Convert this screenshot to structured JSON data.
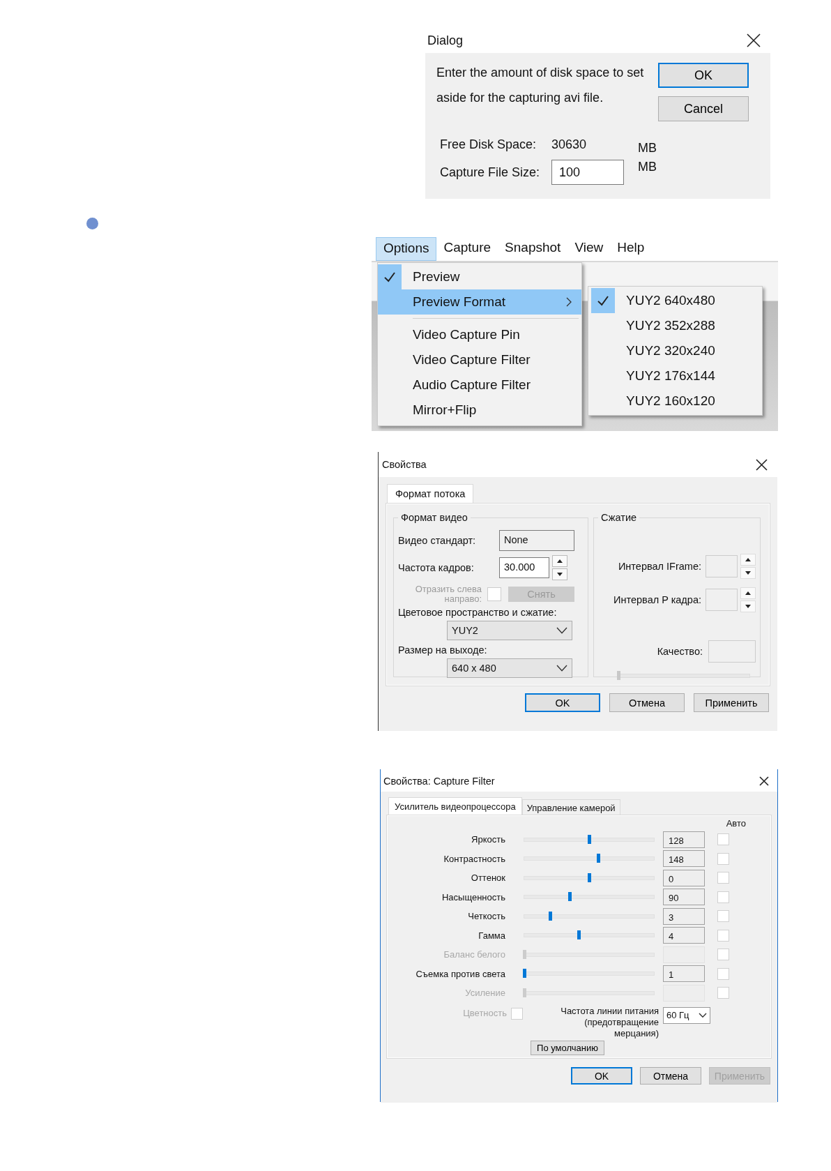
{
  "disk_dialog": {
    "title": "Dialog",
    "message": "Enter the amount of disk space to set aside for the capturing avi file.",
    "buttons": [
      {
        "label": "OK",
        "default": true
      },
      {
        "label": "Cancel",
        "default": false
      }
    ],
    "free_space": {
      "label": "Free Disk Space:",
      "value": "30630",
      "unit": "MB"
    },
    "file_size": {
      "label": "Capture File Size:",
      "value": "100",
      "unit": "MB"
    }
  },
  "capture_menu": {
    "menubar": [
      {
        "label": "Options",
        "selected": true
      },
      {
        "label": "Capture",
        "selected": false
      },
      {
        "label": "Snapshot",
        "selected": false
      },
      {
        "label": "View",
        "selected": false
      },
      {
        "label": "Help",
        "selected": false
      }
    ],
    "items": [
      {
        "kind": "item",
        "label": "Preview",
        "checked": true,
        "highlighted": false,
        "submenu": false
      },
      {
        "kind": "item",
        "label": "Preview Format",
        "checked": false,
        "highlighted": true,
        "submenu": true
      },
      {
        "kind": "separator"
      },
      {
        "kind": "item",
        "label": "Video Capture Pin",
        "checked": false,
        "highlighted": false,
        "submenu": false
      },
      {
        "kind": "item",
        "label": "Video Capture Filter",
        "checked": false,
        "highlighted": false,
        "submenu": false
      },
      {
        "kind": "item",
        "label": "Audio Capture Filter",
        "checked": false,
        "highlighted": false,
        "submenu": false
      },
      {
        "kind": "item",
        "label": "Mirror+Flip",
        "checked": false,
        "highlighted": false,
        "submenu": false
      }
    ],
    "submenu": [
      {
        "label": "YUY2 640x480",
        "checked": true
      },
      {
        "label": "YUY2 352x288",
        "checked": false
      },
      {
        "label": "YUY2 320x240",
        "checked": false
      },
      {
        "label": "YUY2 176x144",
        "checked": false
      },
      {
        "label": "YUY2 160x120",
        "checked": false
      }
    ]
  },
  "properties": {
    "title": "Свойства",
    "tabs": [
      {
        "label": "Формат потока",
        "selected": true
      }
    ],
    "video_format": {
      "title": "Формат видео",
      "standard": {
        "label": "Видео стандарт:",
        "value": "None"
      },
      "frame_rate": {
        "label": "Частота кадров:",
        "value": "30.000"
      },
      "mirror": {
        "label": "Отразить слева направо:",
        "checked": false,
        "disabled": true,
        "button": "Снять"
      },
      "color_space": {
        "label": "Цветовое пространство и сжатие:",
        "value": "YUY2"
      },
      "output_size": {
        "label": "Размер на выходе:",
        "value": "640 x 480"
      }
    },
    "compression": {
      "title": "Сжатие",
      "disabled": true,
      "iframe_label": "Интервал IFrame:",
      "pframe_label": "Интервал P кадра:",
      "quality_label": "Качество:",
      "quality": {
        "level": 0
      }
    },
    "buttons": [
      {
        "label": "OK",
        "default": true,
        "disabled": false
      },
      {
        "label": "Отмена",
        "default": false,
        "disabled": false
      },
      {
        "label": "Применить",
        "default": false,
        "disabled": false
      }
    ]
  },
  "capture_filter": {
    "title": "Свойства: Capture Filter",
    "tabs": [
      {
        "label": "Усилитель видеопроцессора",
        "selected": true
      },
      {
        "label": "Управление камерой",
        "selected": false
      }
    ],
    "auto_header": "Авто",
    "rows": [
      {
        "label": "Яркость",
        "level": 0.5,
        "value": "128",
        "auto": false,
        "disabled": false
      },
      {
        "label": "Контрастность",
        "level": 0.57,
        "value": "148",
        "auto": false,
        "disabled": false
      },
      {
        "label": "Оттенок",
        "level": 0.5,
        "value": "0",
        "auto": false,
        "disabled": false
      },
      {
        "label": "Насыщенность",
        "level": 0.35,
        "value": "90",
        "auto": false,
        "disabled": false
      },
      {
        "label": "Четкость",
        "level": 0.2,
        "value": "3",
        "auto": false,
        "disabled": false
      },
      {
        "label": "Гамма",
        "level": 0.42,
        "value": "4",
        "auto": false,
        "disabled": false
      },
      {
        "label": "Баланс белого",
        "level": 0,
        "auto": false,
        "disabled": true
      },
      {
        "label": "Съемка против света",
        "level": 0,
        "value": "1",
        "auto": false,
        "disabled": false
      },
      {
        "label": "Усиление",
        "level": 0,
        "auto": false,
        "disabled": true
      }
    ],
    "color": {
      "label": "Цветность",
      "checked": false,
      "disabled": true
    },
    "power_line": {
      "label": "Частота линии питания (предотвращение мерцания)",
      "value": "60 Гц"
    },
    "default_button": "По умолчанию",
    "buttons": [
      {
        "label": "OK",
        "default": true,
        "disabled": false
      },
      {
        "label": "Отмена",
        "default": false,
        "disabled": false
      },
      {
        "label": "Применить",
        "default": false,
        "disabled": true
      }
    ]
  }
}
